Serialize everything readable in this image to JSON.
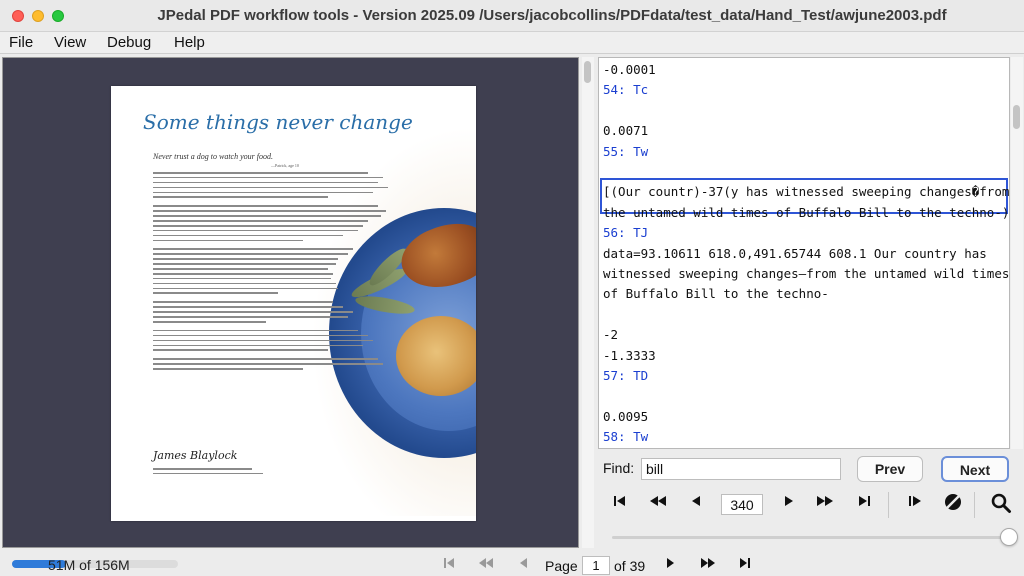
{
  "window": {
    "title": "JPedal PDF workflow tools - Version 2025.09 /Users/jacobcollins/PDFdata/test_data/Hand_Test/awjune2003.pdf"
  },
  "menu": [
    "File",
    "View",
    "Debug",
    "Help"
  ],
  "document_page": {
    "heading": "Some things never change",
    "subheading": "Never trust a dog to watch your food.",
    "credit": "—Patrick, age 10",
    "signature": "James Blaylock"
  },
  "code_panel": {
    "lines": [
      {
        "text": "-0.0001",
        "kind": "value"
      },
      {
        "text": "54: Tc",
        "kind": "op"
      },
      {
        "text": "",
        "kind": "value"
      },
      {
        "text": "0.0071",
        "kind": "value"
      },
      {
        "text": "55: Tw",
        "kind": "op"
      },
      {
        "text": "",
        "kind": "value"
      },
      {
        "text": "[(Our countr)-37(y has witnessed sweeping changes�from",
        "kind": "value"
      },
      {
        "text": "the untamed wild times of Buffalo Bill to the techno-)",
        "kind": "value"
      },
      {
        "text": "56: TJ",
        "kind": "op"
      },
      {
        "text": "data=93.10611 618.0,491.65744 608.1 Our country has",
        "kind": "value"
      },
      {
        "text": "witnessed sweeping changes—from the untamed wild times",
        "kind": "value"
      },
      {
        "text": "of Buffalo Bill to the techno-",
        "kind": "value"
      },
      {
        "text": "",
        "kind": "value"
      },
      {
        "text": "-2",
        "kind": "value"
      },
      {
        "text": "-1.3333",
        "kind": "value"
      },
      {
        "text": "57: TD",
        "kind": "op"
      },
      {
        "text": "",
        "kind": "value"
      },
      {
        "text": "0.0095",
        "kind": "value"
      },
      {
        "text": "58: Tw",
        "kind": "op"
      }
    ]
  },
  "find": {
    "label": "Find:",
    "value": "bill",
    "prev_label": "Prev",
    "next_label": "Next"
  },
  "playback": {
    "step_value": "340",
    "icons": [
      "first-step-icon",
      "rewind-icon",
      "step-back-icon",
      "step-forward-icon",
      "fast-forward-icon",
      "last-step-icon",
      "step-into-icon",
      "no-stop-icon",
      "search-icon"
    ],
    "slider_fraction": 1.0
  },
  "status": {
    "memory_text": "51M of 156M",
    "memory_fraction": 0.327
  },
  "navigation": {
    "page_label": "Page",
    "page_value": "1",
    "page_total": "of 39"
  }
}
